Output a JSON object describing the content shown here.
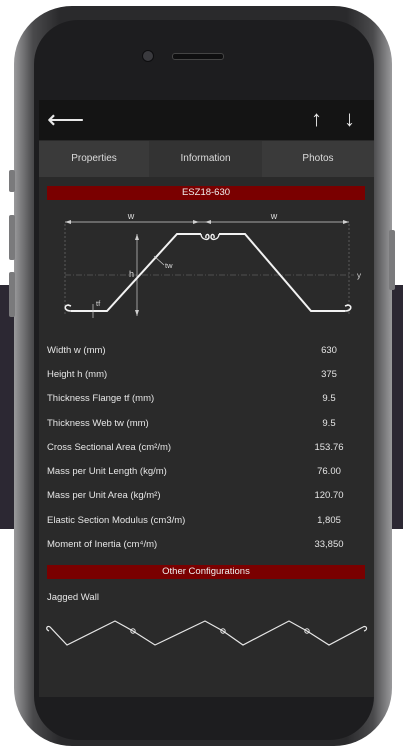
{
  "appbar": {
    "back_icon": "arrow-left-icon",
    "up_icon": "arrow-up-icon",
    "down_icon": "arrow-down-icon",
    "back_glyph": "⟵",
    "up_glyph": "↑",
    "down_glyph": "↓"
  },
  "tabs": [
    {
      "label": "Properties",
      "active": true
    },
    {
      "label": "Information",
      "active": false
    },
    {
      "label": "Photos",
      "active": false
    }
  ],
  "section_title": "ESZ18-630",
  "diagram": {
    "label_w_left": "w",
    "label_w_right": "w",
    "label_h": "h",
    "label_tw": "tw",
    "label_tf": "tf",
    "label_y": "y"
  },
  "properties": [
    {
      "label": "Width w (mm)",
      "value": "630"
    },
    {
      "label": "Height h (mm)",
      "value": "375"
    },
    {
      "label": "Thickness Flange tf (mm)",
      "value": "9.5"
    },
    {
      "label": "Thickness Web tw (mm)",
      "value": "9.5"
    },
    {
      "label": "Cross Sectional Area (cm²/m)",
      "value": "153.76"
    },
    {
      "label": "Mass per Unit Length (kg/m)",
      "value": "76.00"
    },
    {
      "label": "Mass per Unit Area (kg/m²)",
      "value": "120.70"
    },
    {
      "label": "Elastic Section Modulus (cm3/m)",
      "value": "1,805"
    },
    {
      "label": "Moment of Inertia (cm⁴/m)",
      "value": "33,850"
    }
  ],
  "other_configurations": {
    "title": "Other Configurations",
    "items": [
      {
        "label": "Jagged Wall"
      }
    ]
  },
  "colors": {
    "accent_red": "#7a0000",
    "screen_bg": "#2a2a2a",
    "appbar_bg": "#141414"
  }
}
